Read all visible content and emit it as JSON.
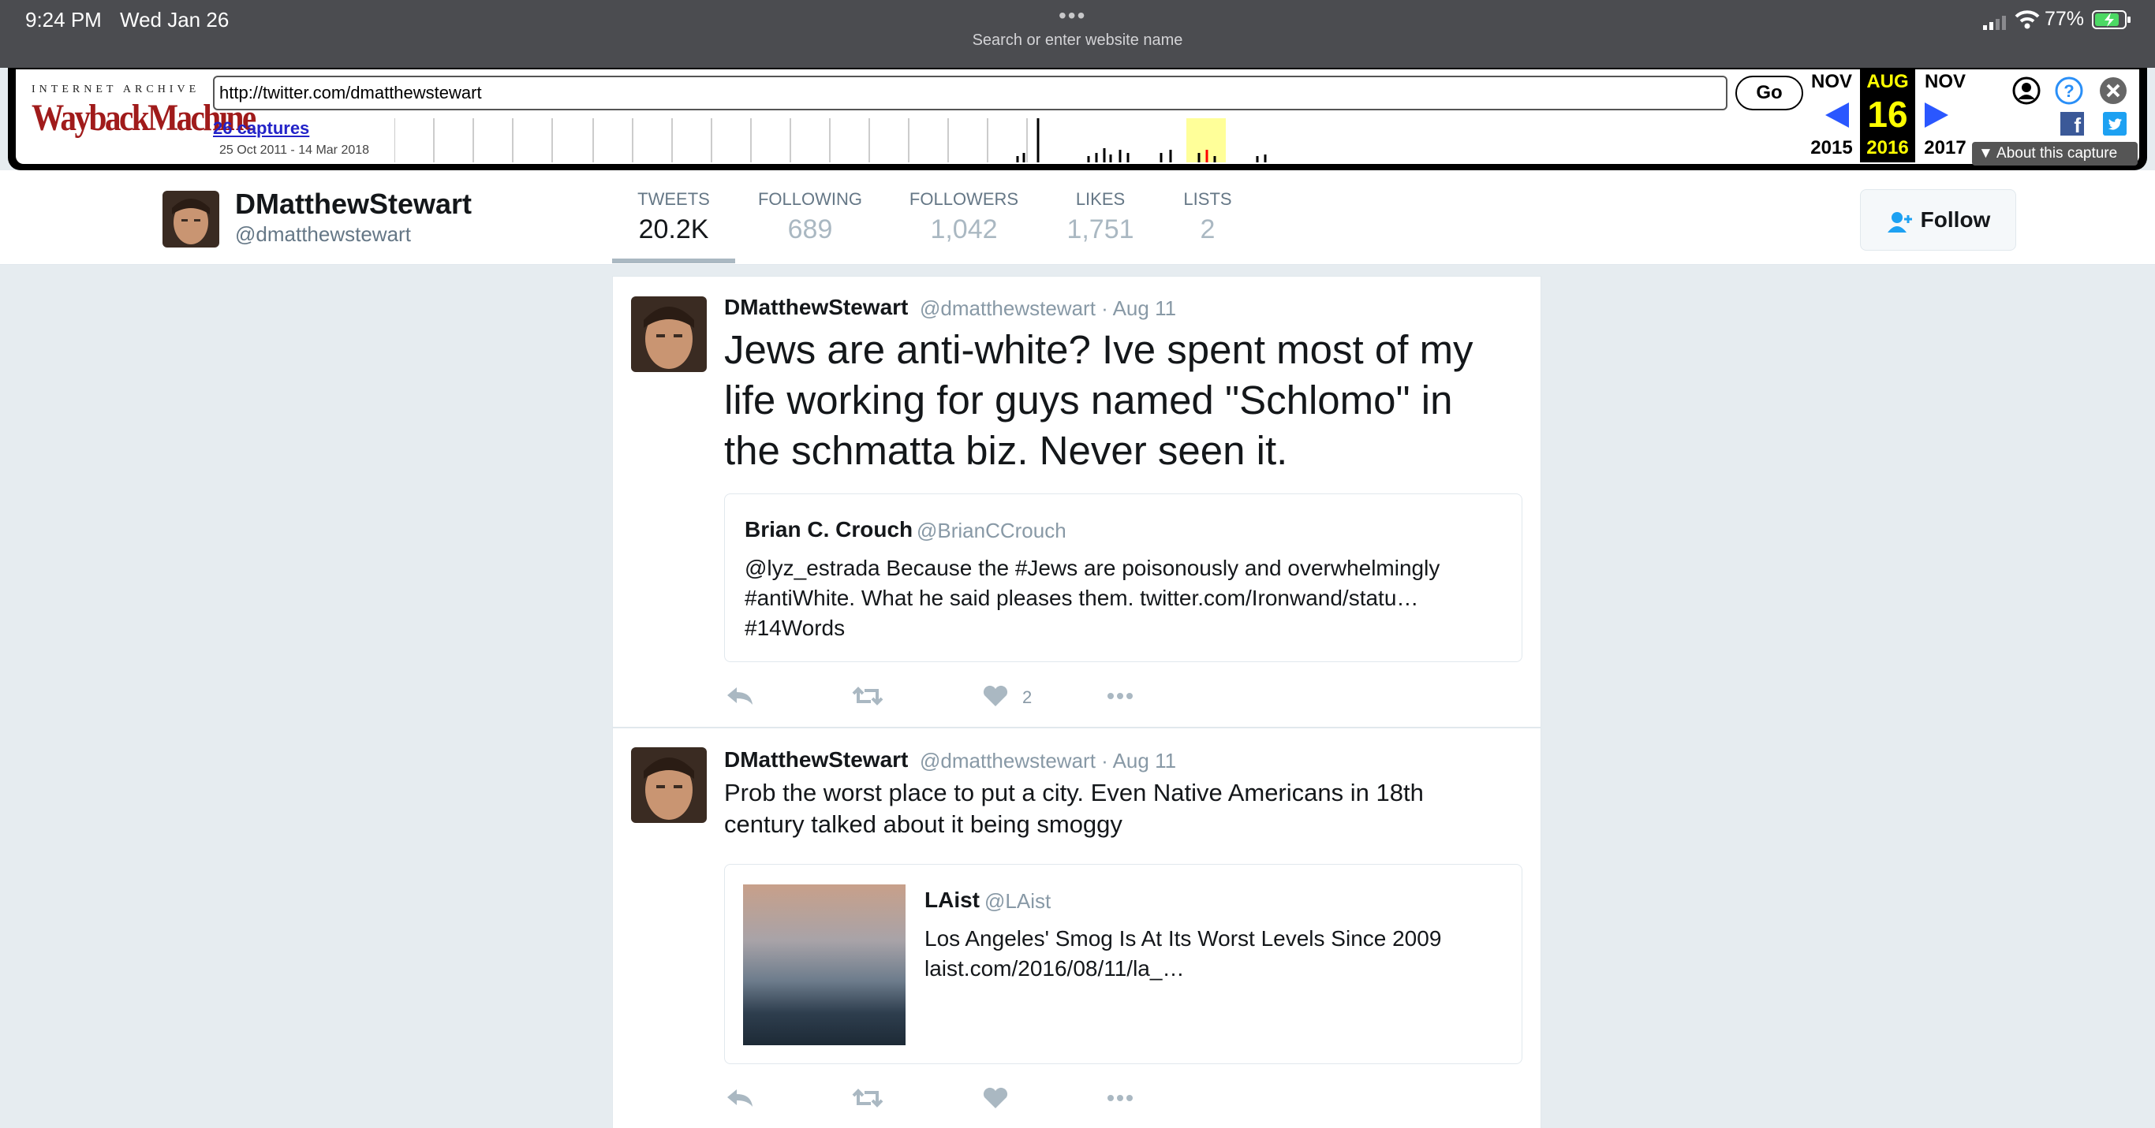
{
  "status_bar": {
    "time": "9:24 PM",
    "date": "Wed Jan 26",
    "address_placeholder": "Search or enter website name",
    "battery": "77%"
  },
  "wayback": {
    "brand_top": "INTERNET ARCHIVE",
    "brand_logo": "WaybackMachine",
    "url": "http://twitter.com/dmatthewstewart",
    "go_label": "Go",
    "captures_link": "26 captures",
    "captures_range": "25 Oct 2011 - 14 Mar 2018",
    "calendar": {
      "prev_month": "NOV",
      "prev_year": "2015",
      "current_month": "AUG",
      "current_day": "16",
      "current_year": "2016",
      "next_month": "NOV",
      "next_year": "2017"
    },
    "about_capture": "About this capture",
    "colors": {
      "logo": "#a01b1b",
      "current_highlight": "#ffff00",
      "arrows": "#2a57ff",
      "link": "#2323c8"
    }
  },
  "profile": {
    "name": "DMatthewStewart",
    "handle": "@dmatthewstewart",
    "stats": [
      {
        "label": "TWEETS",
        "value": "20.2K"
      },
      {
        "label": "FOLLOWING",
        "value": "689"
      },
      {
        "label": "FOLLOWERS",
        "value": "1,042"
      },
      {
        "label": "LIKES",
        "value": "1,751"
      },
      {
        "label": "LISTS",
        "value": "2"
      }
    ],
    "follow_label": "Follow"
  },
  "tweets": [
    {
      "name": "DMatthewStewart",
      "meta": "@dmatthewstewart · Aug 11",
      "text_lines": [
        "Jews are anti-white? Ive spent most of my",
        "life working for guys named \"Schlomo\" in",
        "the schmatta biz. Never seen it."
      ],
      "quote": {
        "name": "Brian C. Crouch",
        "handle": "@BrianCCrouch",
        "lines": [
          "@lyz_estrada Because the #Jews are poisonously and overwhelmingly",
          "#antiWhite. What he said pleases them. twitter.com/Ironwand/statu…",
          "#14Words"
        ]
      },
      "like_count": "2"
    },
    {
      "name": "DMatthewStewart",
      "meta": "@dmatthewstewart · Aug 11",
      "text_lines": [
        "Prob the worst place to put a city. Even Native Americans in 18th",
        "century talked about it being smoggy"
      ],
      "card": {
        "name": "LAist",
        "handle": "@LAist",
        "lines": [
          "Los Angeles' Smog Is At Its Worst Levels Since 2009",
          "laist.com/2016/08/11/la_…"
        ]
      }
    }
  ]
}
